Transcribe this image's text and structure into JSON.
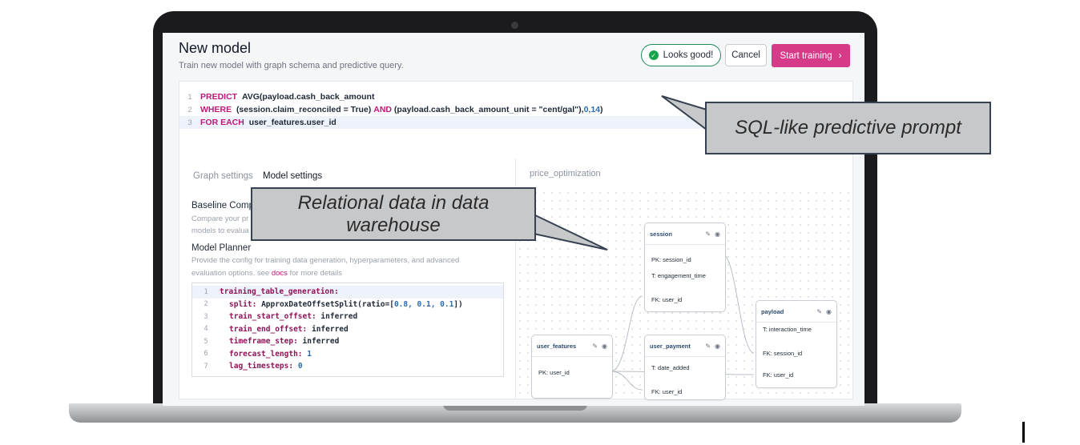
{
  "header": {
    "title": "New model",
    "subtitle": "Train new model with graph schema and predictive query.",
    "status_label": "Looks good!",
    "cancel_label": "Cancel",
    "start_label": "Start training",
    "start_chevron": "›"
  },
  "query": {
    "lines": [
      {
        "num": "1",
        "kw1": "PREDICT",
        "t1": "AVG(payload.cash_back_amount",
        "kw2": "",
        "t2": "",
        "n": "",
        "t3": ""
      },
      {
        "num": "2",
        "kw1": "WHERE",
        "t1": "(session.claim_reconciled = True)",
        "kw2": "AND",
        "t2": "(payload.cash_back_amount_unit = \"cent/gal\"),",
        "n": "0,14",
        "t3": ")"
      },
      {
        "num": "3",
        "kw1": "FOR EACH",
        "t1": "user_features.user_id",
        "kw2": "",
        "t2": "",
        "n": "",
        "t3": ""
      }
    ]
  },
  "tabs": {
    "graph_settings": "Graph settings",
    "model_settings": "Model settings"
  },
  "settings": {
    "baseline_title": "Baseline Comp",
    "baseline_desc_1": "Compare your pr",
    "baseline_desc_2": "models to evalua",
    "planner_title": "Model Planner",
    "planner_desc_1": "Provide the config for training data generation, hyperparameters, and advanced",
    "planner_desc_2_pre": "evaluation options. see",
    "planner_link": "docs",
    "planner_desc_2_post": "for more details"
  },
  "yaml": [
    {
      "num": "1",
      "key": "training_table_generation:",
      "val": "",
      "n": "",
      "tail": ""
    },
    {
      "num": "2",
      "key": "split:",
      "val": "ApproxDateOffsetSplit(ratio=[",
      "n": "0.8, 0.1, 0.1",
      "tail": "])"
    },
    {
      "num": "3",
      "key": "train_start_offset:",
      "val": "inferred",
      "n": "",
      "tail": ""
    },
    {
      "num": "4",
      "key": "train_end_offset:",
      "val": "inferred",
      "n": "",
      "tail": ""
    },
    {
      "num": "5",
      "key": "timeframe_step:",
      "val": "inferred",
      "n": "",
      "tail": ""
    },
    {
      "num": "6",
      "key": "forecast_length:",
      "val": "",
      "n": "1",
      "tail": ""
    },
    {
      "num": "7",
      "key": "lag_timesteps:",
      "val": "",
      "n": "0",
      "tail": ""
    }
  ],
  "graph": {
    "title": "price_optimization",
    "tables": {
      "session": {
        "name": "session",
        "fields": [
          "PK: session_id",
          "T: engagement_time",
          "FK: user_id"
        ]
      },
      "payload": {
        "name": "payload",
        "fields": [
          "T: interaction_time",
          "FK: session_id",
          "FK: user_id"
        ]
      },
      "user_features": {
        "name": "user_features",
        "fields": [
          "PK: user_id"
        ]
      },
      "user_payment": {
        "name": "user_payment",
        "fields": [
          "T: date_added",
          "FK: user_id"
        ]
      }
    },
    "edit_icon": "✎",
    "view_icon": "◉"
  },
  "callouts": {
    "sql": "SQL-like predictive prompt",
    "relational_1": "Relational data in data",
    "relational_2": "warehouse"
  },
  "colors": {
    "accent": "#d63b8a",
    "keyword": "#c0157a",
    "success": "#16a34a"
  }
}
